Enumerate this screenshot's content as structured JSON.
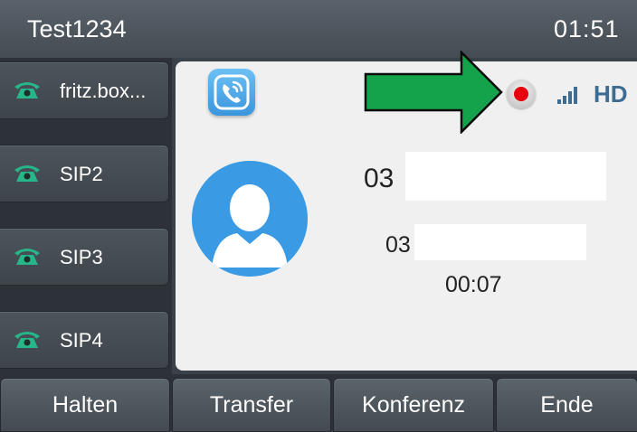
{
  "header": {
    "account": "Test1234",
    "time": "01:51"
  },
  "lines": [
    {
      "label": "fritz.box...",
      "icon": "phone-icon"
    },
    {
      "label": "SIP2",
      "icon": "phone-icon"
    },
    {
      "label": "SIP3",
      "icon": "phone-icon"
    },
    {
      "label": "SIP4",
      "icon": "phone-icon"
    }
  ],
  "call": {
    "app_icon": "call-app-icon",
    "recording_icon": "record-icon",
    "signal_icon": "signal-bars-icon",
    "hd_label": "HD",
    "number_prefix": "03",
    "secondary_prefix": "03",
    "duration": "00:07",
    "avatar_icon": "contact-avatar-icon"
  },
  "softkeys": [
    {
      "label": "Halten"
    },
    {
      "label": "Transfer"
    },
    {
      "label": "Konferenz"
    },
    {
      "label": "Ende"
    }
  ],
  "annotation": {
    "arrow_icon": "green-arrow-icon",
    "arrow_color": "#14a34a"
  },
  "colors": {
    "record_dot": "#e8000d",
    "hd": "#3d6d95",
    "phone_icon": "#27b58a",
    "avatar_bg": "#3a9be4"
  }
}
